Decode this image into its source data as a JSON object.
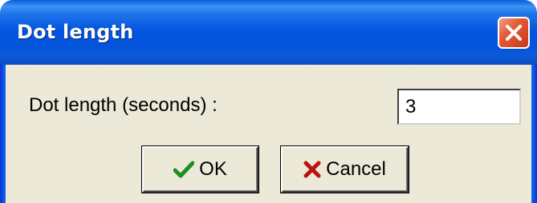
{
  "window": {
    "title": "Dot length",
    "close_icon": "close-icon"
  },
  "form": {
    "label": "Dot length (seconds) :",
    "value": "3"
  },
  "buttons": {
    "ok": {
      "label": "OK",
      "icon": "checkmark-icon"
    },
    "cancel": {
      "label": "Cancel",
      "icon": "x-icon"
    }
  },
  "colors": {
    "titlebar": "#0454dc",
    "client_background": "#ece9d8",
    "close_button": "#e35a35",
    "ok_icon": "#1e8f1e",
    "cancel_icon": "#b81414"
  }
}
